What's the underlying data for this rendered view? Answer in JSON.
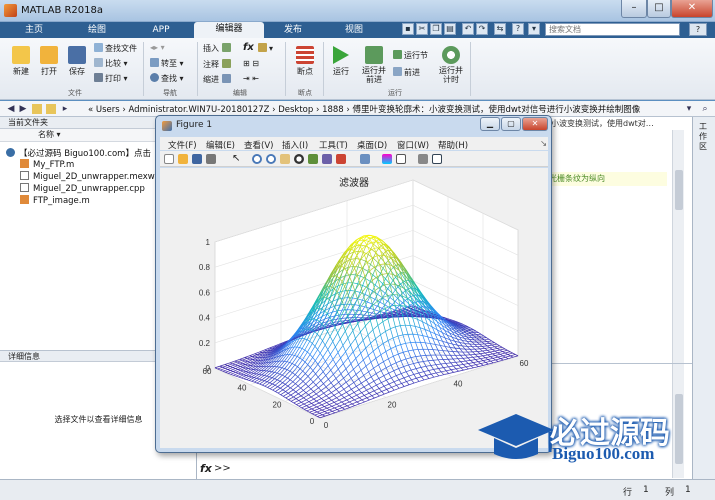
{
  "window": {
    "title": "MATLAB R2018a",
    "min": "–",
    "max": "□",
    "close": "✕"
  },
  "tabs": [
    "主页",
    "绘图",
    "APP",
    "编辑器",
    "发布",
    "视图"
  ],
  "search": {
    "placeholder": "搜索文档",
    "help": "?"
  },
  "ribbon": {
    "file": {
      "new": "新建",
      "open": "打开",
      "save": "保存",
      "find_files": "查找文件",
      "compare": "比较",
      "print": "打印",
      "group": "文件"
    },
    "nav": {
      "goto": "转至",
      "find": "查找",
      "group": "导航"
    },
    "edit": {
      "insert": "插入",
      "comment": "注释",
      "indent": "缩进",
      "fx": "fx",
      "group": "编辑"
    },
    "breakpoints": {
      "label": "断点",
      "group": "断点"
    },
    "run": {
      "run": "运行",
      "run_advance": "运行并\n前进",
      "run_section": "运行节",
      "advance": "前进",
      "run_time": "运行并\n计时",
      "group": "运行"
    }
  },
  "address": {
    "path": "« Users › Administrator.WIN7U-20180127Z › Desktop › 1888 › 傅里叶变换轮廓术：小波变换测试，使用dwt对信号进行小波变换并绘制图像"
  },
  "current_folder": {
    "title": "当前文件夹",
    "column": "名称 ▾",
    "files": [
      "【必过源码 Biguo100.com】点击",
      "My_FTP.m",
      "Miguel_2D_unwrapper.mexw64",
      "Miguel_2D_unwrapper.cpp",
      "FTP_image.m"
    ]
  },
  "details": {
    "title": "详细信息",
    "text": "选择文件以查看详细信息"
  },
  "editor": {
    "tab": "小波变换测试，使用dwt对…",
    "note": "光栅条纹为纵向"
  },
  "workspace": {
    "label": "工作区"
  },
  "command": {
    "fx": "fx",
    "prompt": ">>"
  },
  "status": {
    "row_label": "行",
    "row": "1",
    "col_label": "列",
    "col": "1"
  },
  "figure": {
    "title": "Figure 1",
    "min": "▁",
    "max": "▢",
    "close": "✕",
    "menus": [
      "文件(F)",
      "编辑(E)",
      "查看(V)",
      "插入(I)",
      "工具(T)",
      "桌面(D)",
      "窗口(W)",
      "帮助(H)"
    ]
  },
  "logo": {
    "name": "必过源码",
    "url": "Biguo100.com"
  },
  "chart_data": {
    "type": "surface",
    "title": "滤波器",
    "x_ticks": [
      0,
      20,
      40,
      60
    ],
    "y_ticks": [
      0,
      20,
      40,
      60
    ],
    "z_ticks": [
      0,
      0.2,
      0.4,
      0.6,
      0.8,
      1
    ],
    "xlim": [
      0,
      60
    ],
    "ylim": [
      0,
      60
    ],
    "zlim": [
      0,
      1
    ],
    "function": "gaussian",
    "center": [
      30,
      30
    ],
    "sigma": 12,
    "peak": 1,
    "colormap": "parula",
    "grid": true
  }
}
